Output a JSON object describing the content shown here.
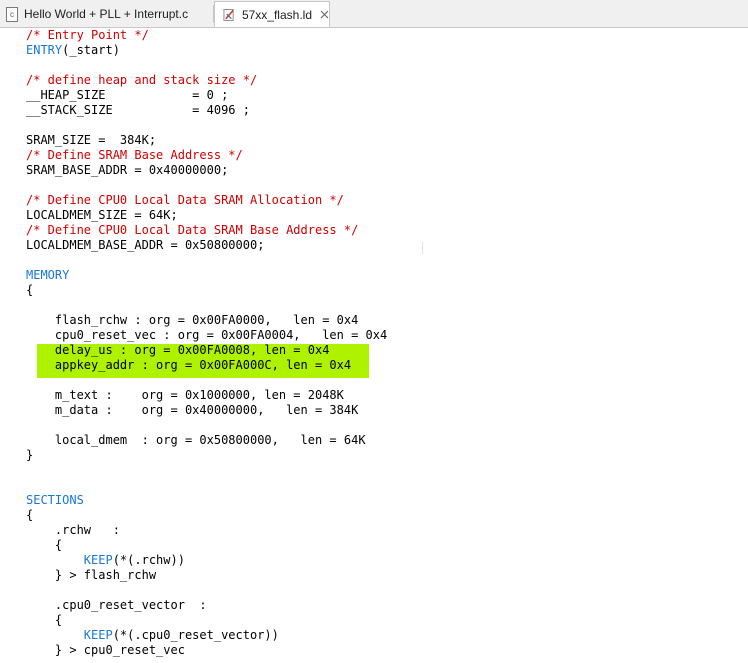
{
  "tabs": [
    {
      "label": "Hello World + PLL + Interrupt.c",
      "icon": "c-file-icon",
      "active": false
    },
    {
      "label": "57xx_flash.ld",
      "icon": "linker-file-icon",
      "active": true
    }
  ],
  "colors": {
    "comment": "#d10000",
    "keyword": "#1878d8",
    "highlight": "#aef200"
  },
  "editor": {
    "lines": [
      [
        {
          "t": "/* Entry Point */",
          "c": "cm"
        }
      ],
      [
        {
          "t": "ENTRY",
          "c": "kw"
        },
        {
          "t": "(_start)"
        }
      ],
      [],
      [
        {
          "t": "/* define heap and stack size */",
          "c": "cm"
        }
      ],
      [
        {
          "t": "__HEAP_SIZE            = 0 ;"
        }
      ],
      [
        {
          "t": "__STACK_SIZE           = 4096 ;"
        }
      ],
      [],
      [
        {
          "t": "SRAM_SIZE =  384K;"
        }
      ],
      [
        {
          "t": "/* Define SRAM Base Address */",
          "c": "cm"
        }
      ],
      [
        {
          "t": "SRAM_BASE_ADDR = 0x40000000;"
        }
      ],
      [],
      [
        {
          "t": "/* Define CPU0 Local Data SRAM Allocation */",
          "c": "cm"
        }
      ],
      [
        {
          "t": "LOCALDMEM_SIZE = 64K;"
        }
      ],
      [
        {
          "t": "/* Define CPU0 Local Data SRAM Base Address */",
          "c": "cm"
        }
      ],
      [
        {
          "t": "LOCALDMEM_BASE_ADDR = 0x50800000;"
        }
      ],
      [],
      [
        {
          "t": "MEMORY",
          "c": "kw"
        }
      ],
      [
        {
          "t": "{"
        }
      ],
      [],
      [
        {
          "t": "    flash_rchw : org = 0x00FA0000,   len = 0x4"
        }
      ],
      [
        {
          "t": "    cpu0_reset_vec : org = 0x00FA0004,   len = 0x4"
        }
      ],
      [
        {
          "t": "    delay_us : org = 0x00FA0008, len = 0x4"
        }
      ],
      [
        {
          "t": "    appkey_addr : org = 0x00FA000C, len = 0x4"
        }
      ],
      [],
      [
        {
          "t": "    m_text :    org = 0x1000000, len = 2048K"
        }
      ],
      [
        {
          "t": "    m_data :    org = 0x40000000,   len = 384K"
        }
      ],
      [],
      [
        {
          "t": "    local_dmem  : org = 0x50800000,   len = 64K"
        }
      ],
      [
        {
          "t": "}"
        }
      ],
      [],
      [],
      [
        {
          "t": "SECTIONS",
          "c": "kw"
        }
      ],
      [
        {
          "t": "{"
        }
      ],
      [
        {
          "t": "    .rchw   :"
        }
      ],
      [
        {
          "t": "    {"
        }
      ],
      [
        {
          "t": "        "
        },
        {
          "t": "KEEP",
          "c": "kw"
        },
        {
          "t": "(*(.rchw))"
        }
      ],
      [
        {
          "t": "    } > flash_rchw"
        }
      ],
      [],
      [
        {
          "t": "    .cpu0_reset_vector  :"
        }
      ],
      [
        {
          "t": "    {"
        }
      ],
      [
        {
          "t": "        "
        },
        {
          "t": "KEEP",
          "c": "kw"
        },
        {
          "t": "(*(.cpu0_reset_vector))"
        }
      ],
      [
        {
          "t": "    } > cpu0_reset_vec"
        }
      ]
    ]
  }
}
